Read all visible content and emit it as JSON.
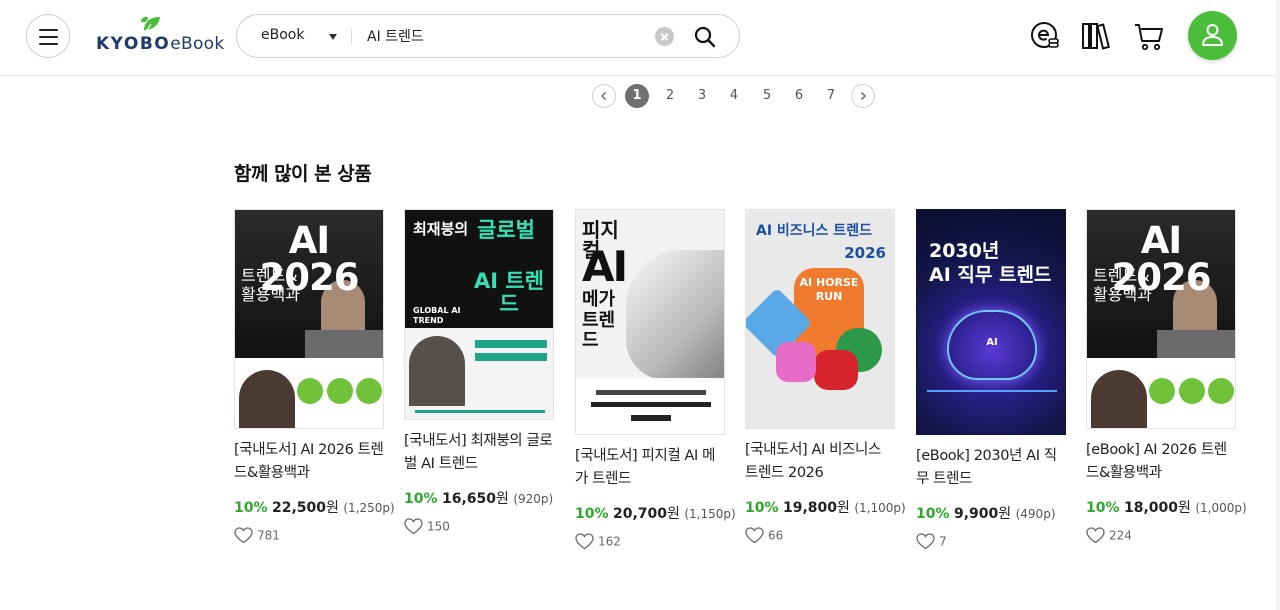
{
  "header": {
    "logo_main": "KYOBO",
    "logo_sub": "eBook",
    "search": {
      "category": "eBook",
      "query": "AI 트렌드"
    },
    "icons": [
      "menu-icon",
      "ebook-library-icon",
      "bookshelf-icon",
      "cart-icon",
      "user-icon"
    ]
  },
  "pagination": {
    "pages": [
      "1",
      "2",
      "3",
      "4",
      "5",
      "6",
      "7"
    ],
    "current": "1"
  },
  "section": {
    "title": "함께 많이 본 상품"
  },
  "products": [
    {
      "title": "[국내도서] AI 2026 트렌드&활용백과",
      "discount": "10%",
      "price": "22,500",
      "unit": "원",
      "points": "(1,250p)",
      "likes": "781",
      "cover": {
        "line1": "AI 2026",
        "line2": "트렌드&",
        "line3": "활용백과",
        "bg": "#1b1b1b",
        "fg": "#ffffff"
      }
    },
    {
      "title": "[국내도서] 최재붕의 글로벌 AI 트렌드",
      "discount": "10%",
      "price": "16,650",
      "unit": "원",
      "points": "(920p)",
      "likes": "150",
      "cover": {
        "line1": "최재붕의",
        "line2": "글로벌",
        "line3": "AI 트렌드",
        "sub": "GLOBAL AI TREND",
        "bg": "#111111",
        "fg": "#34e0b4"
      }
    },
    {
      "title": "[국내도서] 피지컬 AI 메가 트렌드",
      "discount": "10%",
      "price": "20,700",
      "unit": "원",
      "points": "(1,150p)",
      "likes": "162",
      "cover": {
        "line1": "피지컬",
        "line2": "AI",
        "line3": "메가 트렌드",
        "bg": "#f2f2f2",
        "fg": "#111111"
      }
    },
    {
      "title": "[국내도서] AI 비즈니스 트렌드 2026",
      "discount": "10%",
      "price": "19,800",
      "unit": "원",
      "points": "(1,100p)",
      "likes": "66",
      "cover": {
        "line1": "AI 비즈니스 트렌드",
        "line2": "2026",
        "line3": "AI HORSE RUN",
        "bg": "#e9e9e9",
        "fg": "#1c4fa3"
      }
    },
    {
      "title": "[eBook] 2030년 AI 직무 트렌드",
      "discount": "10%",
      "price": "9,900",
      "unit": "원",
      "points": "(490p)",
      "likes": "7",
      "cover": {
        "line1": "2030년",
        "line2": "AI 직무 트렌드",
        "line3": "AI",
        "bg": "#10123a",
        "fg": "#ffffff"
      }
    },
    {
      "title": "[eBook] AI 2026 트렌드&활용백과",
      "discount": "10%",
      "price": "18,000",
      "unit": "원",
      "points": "(1,000p)",
      "likes": "224",
      "cover": {
        "line1": "AI 2026",
        "line2": "트렌드&",
        "line3": "활용백과",
        "bg": "#1b1b1b",
        "fg": "#ffffff"
      }
    }
  ],
  "colors": {
    "accent_green": "#4cbd3b",
    "discount_green": "#2ea72e",
    "brand_navy": "#1e3a6e"
  }
}
